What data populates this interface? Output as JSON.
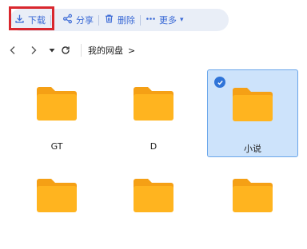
{
  "toolbar": {
    "download": "下载",
    "share": "分享",
    "delete": "删除",
    "more": "更多"
  },
  "breadcrumb": {
    "root": "我的网盘",
    "chevron": ">"
  },
  "folders": [
    {
      "label": "GT",
      "selected": false
    },
    {
      "label": "D",
      "selected": false
    },
    {
      "label": "小说",
      "selected": true
    },
    {
      "label": "",
      "selected": false
    },
    {
      "label": "",
      "selected": false
    },
    {
      "label": "",
      "selected": false
    }
  ],
  "colors": {
    "accent": "#3b6ad6",
    "folder": "#ffb41f",
    "folder_tab": "#f5a015",
    "selected_bg": "#cde3fb",
    "highlight": "#d9272e"
  }
}
